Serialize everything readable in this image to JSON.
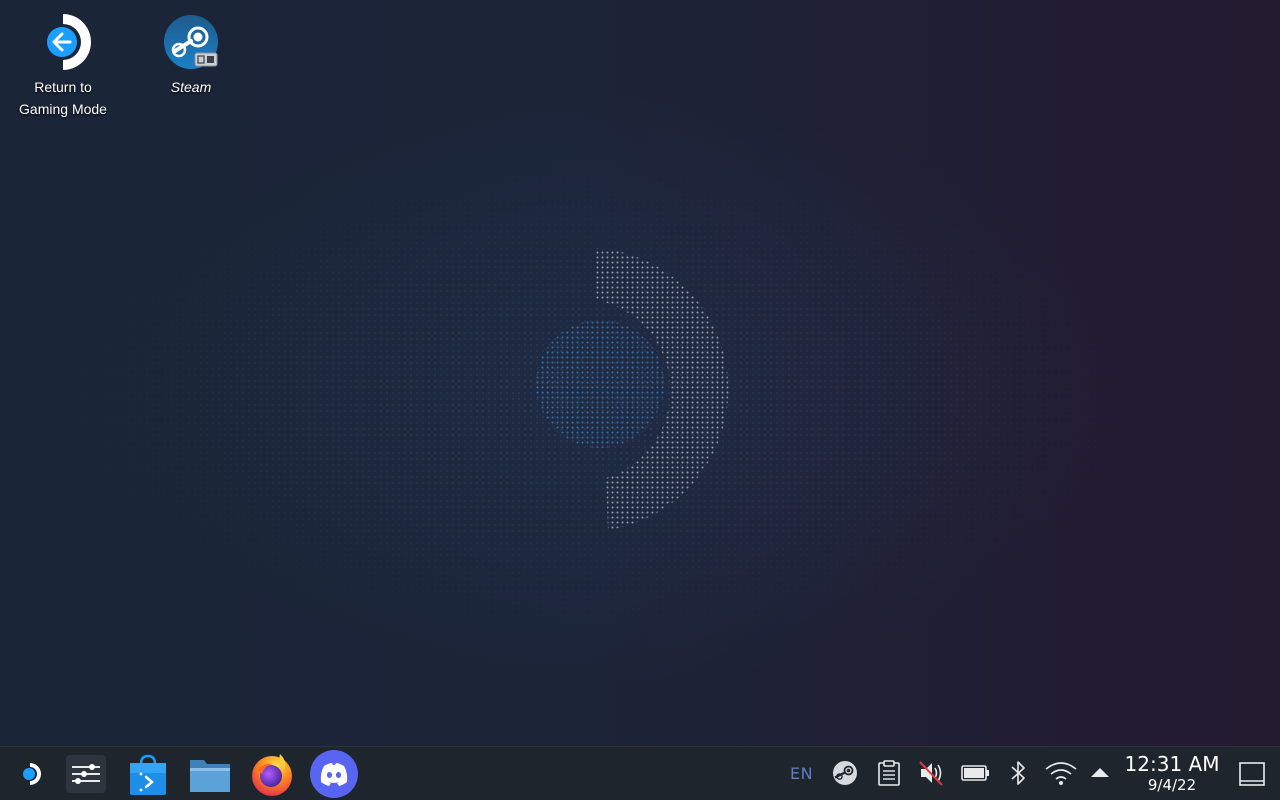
{
  "desktop": {
    "icons": [
      {
        "label": "Return to\nGaming Mode",
        "icon": "return-arrow-icon"
      },
      {
        "label": "Steam",
        "icon": "steam-icon"
      }
    ],
    "wallpaper": "steam-deck-dotted-logo"
  },
  "taskbar": {
    "launcher_icon": "steamos-launcher-icon",
    "pinned": [
      {
        "name": "System Settings",
        "icon": "settings-sliders-icon"
      },
      {
        "name": "Discover",
        "icon": "discover-store-icon"
      },
      {
        "name": "Dolphin",
        "icon": "folder-icon"
      },
      {
        "name": "Firefox",
        "icon": "firefox-icon"
      },
      {
        "name": "Discord",
        "icon": "discord-icon"
      }
    ],
    "tray": {
      "language": "EN",
      "icons": [
        "steam-tray-icon",
        "clipboard-icon",
        "volume-muted-icon",
        "battery-icon",
        "bluetooth-icon",
        "wifi-icon",
        "expand-tray-icon"
      ]
    },
    "clock": {
      "time": "12:31 AM",
      "date": "9/4/22"
    },
    "show_desktop_icon": "show-desktop-icon"
  },
  "colors": {
    "accent": "#1a9fff",
    "taskbar_bg": "#1f252d",
    "language_text": "#5a7fc4",
    "discord": "#5865f2"
  }
}
